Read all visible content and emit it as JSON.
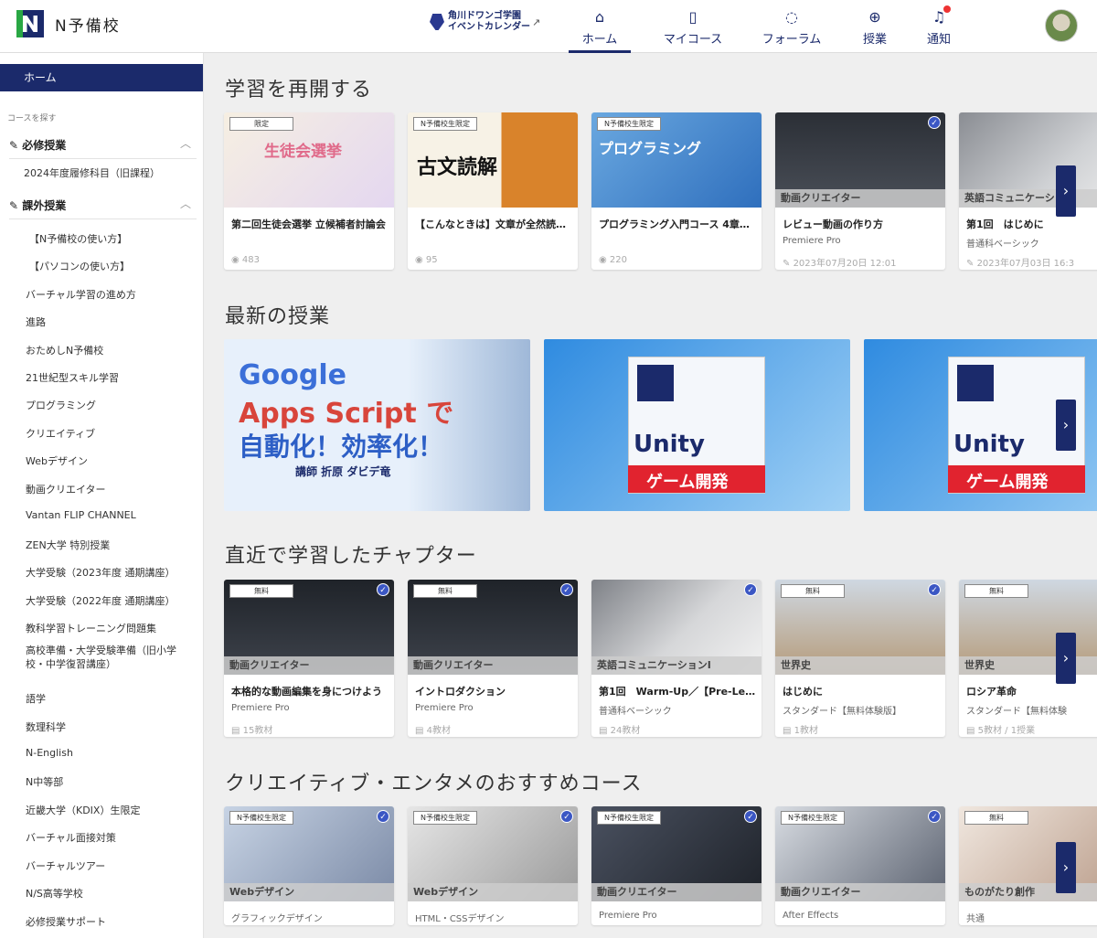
{
  "header": {
    "logo_text": "N予備校",
    "event_line1": "角川ドワンゴ学園",
    "event_line2": "イベントカレンダー",
    "nav": [
      {
        "label": "ホーム",
        "icon": "home-icon",
        "glyph": "⌂"
      },
      {
        "label": "マイコース",
        "icon": "book-icon",
        "glyph": "▯"
      },
      {
        "label": "フォーラム",
        "icon": "chat-icon",
        "glyph": "◌"
      },
      {
        "label": "授業",
        "icon": "globe-icon",
        "glyph": "⊕"
      },
      {
        "label": "通知",
        "icon": "bell-icon",
        "glyph": "♫"
      }
    ]
  },
  "sidebar": {
    "home": "ホーム",
    "caption": "コースを探す",
    "sec1": "必修授業",
    "sec1_item": "2024年度履修科目（旧課程）",
    "sec2": "課外授業",
    "items": [
      "【N予備校の使い方】",
      "【パソコンの使い方】",
      "バーチャル学習の進め方",
      "進路",
      "おためしN予備校",
      "21世紀型スキル学習",
      "プログラミング",
      "クリエイティブ",
      "Webデザイン",
      "動画クリエイター",
      "Vantan FLIP CHANNEL",
      "ZEN大学 特別授業",
      "大学受験（2023年度 通期講座）",
      "大学受験（2022年度 通期講座）",
      "教科学習トレーニング問題集",
      "高校準備・大学受験準備（旧小学校・中学復習講座）",
      "語学",
      "数理科学",
      "N-English",
      "N中等部",
      "近畿大学（KDIX）生限定",
      "バーチャル面接対策",
      "バーチャルツアー",
      "N/S高等学校",
      "必修授業サポート"
    ]
  },
  "sections": {
    "resume": "学習を再開する",
    "latest": "最新の授業",
    "recent": "直近で学習したチャプター",
    "creative": "クリエイティブ・エンタメのおすすめコース"
  },
  "resume_cards": [
    {
      "tag": "限定",
      "title": "第二回生徒会選挙 立候補者討論会",
      "sub": "",
      "meta": "483",
      "thumb_text": "生徒会選挙"
    },
    {
      "tag": "N予備校生限定",
      "title": "【こんなときは】文章が全然読…",
      "sub": "",
      "meta": "95",
      "thumb_text": "古文読解"
    },
    {
      "tag": "N予備校生限定",
      "title": "プログラミング入門コース 4章…",
      "sub": "",
      "meta": "220",
      "thumb_text": "プログラミング"
    },
    {
      "cat": "動画クリエイター",
      "title": "レビュー動画の作り方",
      "sub": "Premiere Pro",
      "meta": "2023年07月20日 12:01"
    },
    {
      "cat": "英語コミュニケーション",
      "title": "第1回　はじめに",
      "sub": "普通科ベーシック",
      "meta": "2023年07月03日 16:3"
    }
  ],
  "latest_cards": [
    {
      "line1": "Google",
      "line2": "Apps Script で",
      "line3": "自動化！効率化！",
      "teacher": "講師 折原 ダビデ竜"
    },
    {
      "line1": "Unity",
      "line2": "ゲーム開発"
    },
    {
      "line1": "Unity",
      "line2": "ゲーム開発"
    }
  ],
  "recent_cards": [
    {
      "tag": "無料",
      "cat": "動画クリエイター",
      "title": "本格的な動画編集を身につけよう",
      "sub": "Premiere Pro",
      "meta": "15教材"
    },
    {
      "tag": "無料",
      "cat": "動画クリエイター",
      "title": "イントロダクション",
      "sub": "Premiere Pro",
      "meta": "4教材"
    },
    {
      "cat": "英語コミュニケーションI",
      "title": "第1回　Warm-Up／【Pre-Less…",
      "sub": "普通科ベーシック",
      "meta": "24教材"
    },
    {
      "tag": "無料",
      "cat": "世界史",
      "title": "はじめに",
      "sub": "スタンダード【無料体験版】",
      "meta": "1教材"
    },
    {
      "tag": "無料",
      "cat": "世界史",
      "title": "ロシア革命",
      "sub": "スタンダード【無料体験",
      "meta": "5教材 / 1授業"
    }
  ],
  "creative_cards": [
    {
      "tag": "N予備校生限定",
      "cat": "Webデザイン",
      "sub": "グラフィックデザイン"
    },
    {
      "tag": "N予備校生限定",
      "cat": "Webデザイン",
      "sub": "HTML・CSSデザイン"
    },
    {
      "tag": "N予備校生限定",
      "cat": "動画クリエイター",
      "sub": "Premiere Pro"
    },
    {
      "tag": "N予備校生限定",
      "cat": "動画クリエイター",
      "sub": "After Effects"
    },
    {
      "tag": "無料",
      "cat": "ものがたり創作",
      "sub": "共通"
    }
  ],
  "colors": {
    "navy": "#1b2a6b",
    "green": "#29a744",
    "check": "#3b57c4"
  }
}
